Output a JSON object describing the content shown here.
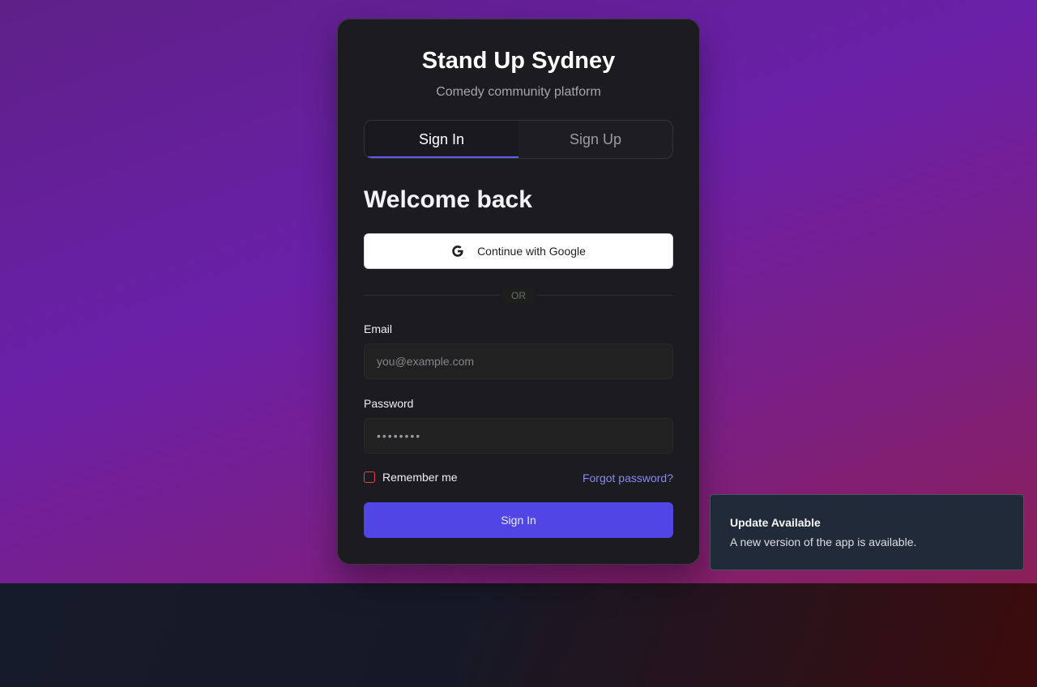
{
  "app": {
    "title": "Stand Up Sydney",
    "subtitle": "Comedy community platform"
  },
  "tabs": [
    {
      "label": "Sign In",
      "active": true
    },
    {
      "label": "Sign Up",
      "active": false
    }
  ],
  "form": {
    "heading": "Welcome back",
    "google_button": "Continue with Google",
    "divider_text": "OR",
    "email": {
      "label": "Email",
      "placeholder": "you@example.com",
      "value": ""
    },
    "password": {
      "label": "Password",
      "value": "••••••••"
    },
    "remember_me": {
      "label": "Remember me",
      "checked": false
    },
    "forgot_password": "Forgot password?",
    "submit": "Sign In"
  },
  "toast": {
    "title": "Update Available",
    "message": "A new version of the app is available."
  },
  "colors": {
    "accent": "#4f46e5",
    "link": "#8b86f0",
    "checkbox_border": "#e0454d",
    "card_bg": "#1c1b20"
  },
  "icons": {
    "google": "google-icon"
  }
}
